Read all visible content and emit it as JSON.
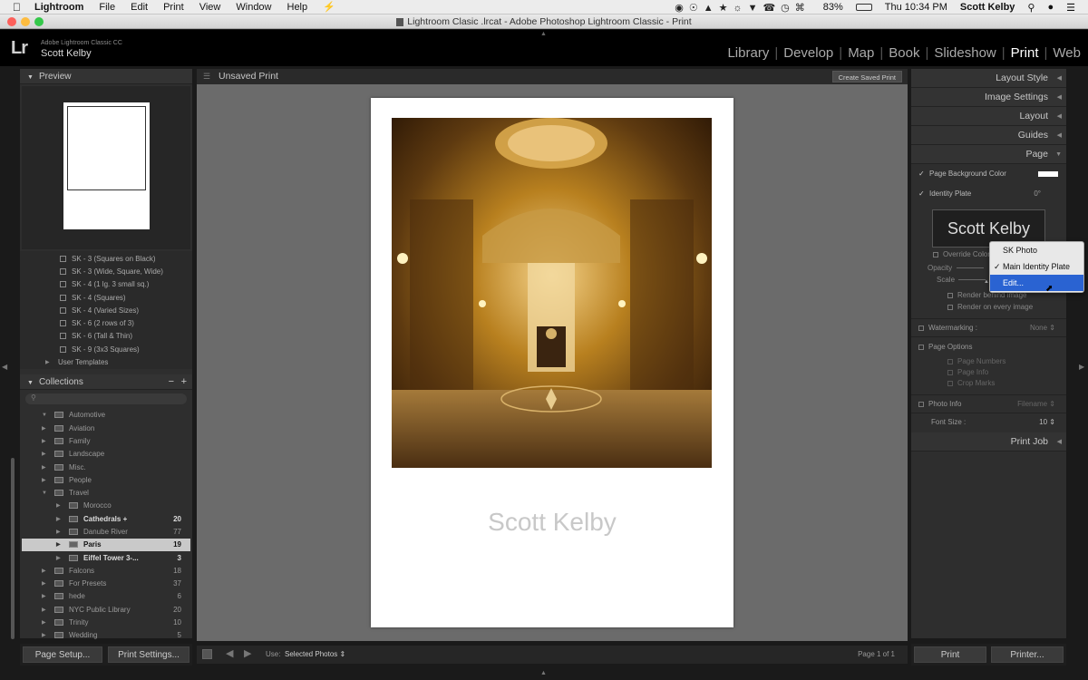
{
  "menubar": {
    "app": "Lightroom",
    "items": [
      "File",
      "Edit",
      "Print",
      "View",
      "Window",
      "Help"
    ],
    "battery": "83%",
    "clock": "Thu 10:34 PM",
    "user": "Scott Kelby"
  },
  "window_title": "Lightroom Clasic .lrcat - Adobe Photoshop Lightroom Classic - Print",
  "identity": {
    "logo": "Lr",
    "subtitle": "Adobe Lightroom Classic CC",
    "name": "Scott Kelby"
  },
  "modules": [
    "Library",
    "Develop",
    "Map",
    "Book",
    "Slideshow",
    "Print",
    "Web"
  ],
  "active_module": "Print",
  "left": {
    "preview_label": "Preview",
    "templates": [
      "SK - 3 (Squares on Black)",
      "SK - 3 (Wide, Square, Wide)",
      "SK - 4 (1 lg. 3 small sq.)",
      "SK - 4 (Squares)",
      "SK - 4 (Varied Sizes)",
      "SK - 6 (2 rows of 3)",
      "SK - 6 (Tall & Thin)",
      "SK - 9 (3x3 Squares)"
    ],
    "user_templates": "User Templates",
    "collections_label": "Collections",
    "collections": [
      {
        "name": "Automotive",
        "count": ""
      },
      {
        "name": "Aviation",
        "count": ""
      },
      {
        "name": "Family",
        "count": ""
      },
      {
        "name": "Landscape",
        "count": ""
      },
      {
        "name": "Misc.",
        "count": ""
      },
      {
        "name": "People",
        "count": ""
      },
      {
        "name": "Travel",
        "count": ""
      },
      {
        "name": "Morocco",
        "count": ""
      },
      {
        "name": "Cathedrals +",
        "count": "20"
      },
      {
        "name": "Danube River",
        "count": "77"
      },
      {
        "name": "Paris",
        "count": "19"
      },
      {
        "name": "Eiffel Tower 3-...",
        "count": "3"
      },
      {
        "name": "Falcons",
        "count": "18"
      },
      {
        "name": "For Presets",
        "count": "37"
      },
      {
        "name": "hede",
        "count": "6"
      },
      {
        "name": "NYC Public Library",
        "count": "20"
      },
      {
        "name": "Trinity",
        "count": "10"
      },
      {
        "name": "Wedding",
        "count": "5"
      }
    ]
  },
  "center": {
    "title": "Unsaved Print",
    "create_button": "Create Saved Print",
    "plate_text": "Scott Kelby",
    "use_label": "Use:",
    "use_value": "Selected Photos",
    "page_info": "Page 1 of 1"
  },
  "right": {
    "sections": [
      "Layout Style",
      "Image Settings",
      "Layout",
      "Guides",
      "Page"
    ],
    "page_bg": "Page Background Color",
    "identity_plate": "Identity Plate",
    "identity_angle": "0°",
    "plate_preview": "Scott Kelby",
    "override_color": "Override Color",
    "opacity": "Opacity",
    "scale": "Scale",
    "render_behind": "Render behind image",
    "render_every": "Render on every image",
    "watermarking": "Watermarking :",
    "watermark_value": "None",
    "page_options": "Page Options",
    "page_numbers": "Page Numbers",
    "page_info": "Page Info",
    "crop_marks": "Crop Marks",
    "photo_info": "Photo Info",
    "photo_info_value": "Filename",
    "font_size": "Font Size :",
    "font_size_value": "10",
    "print_job": "Print Job"
  },
  "dropdown": [
    "SK Photo",
    "Main Identity Plate",
    "Edit..."
  ],
  "bottom": {
    "page_setup": "Page Setup...",
    "print_settings": "Print Settings...",
    "print": "Print",
    "printer": "Printer..."
  }
}
